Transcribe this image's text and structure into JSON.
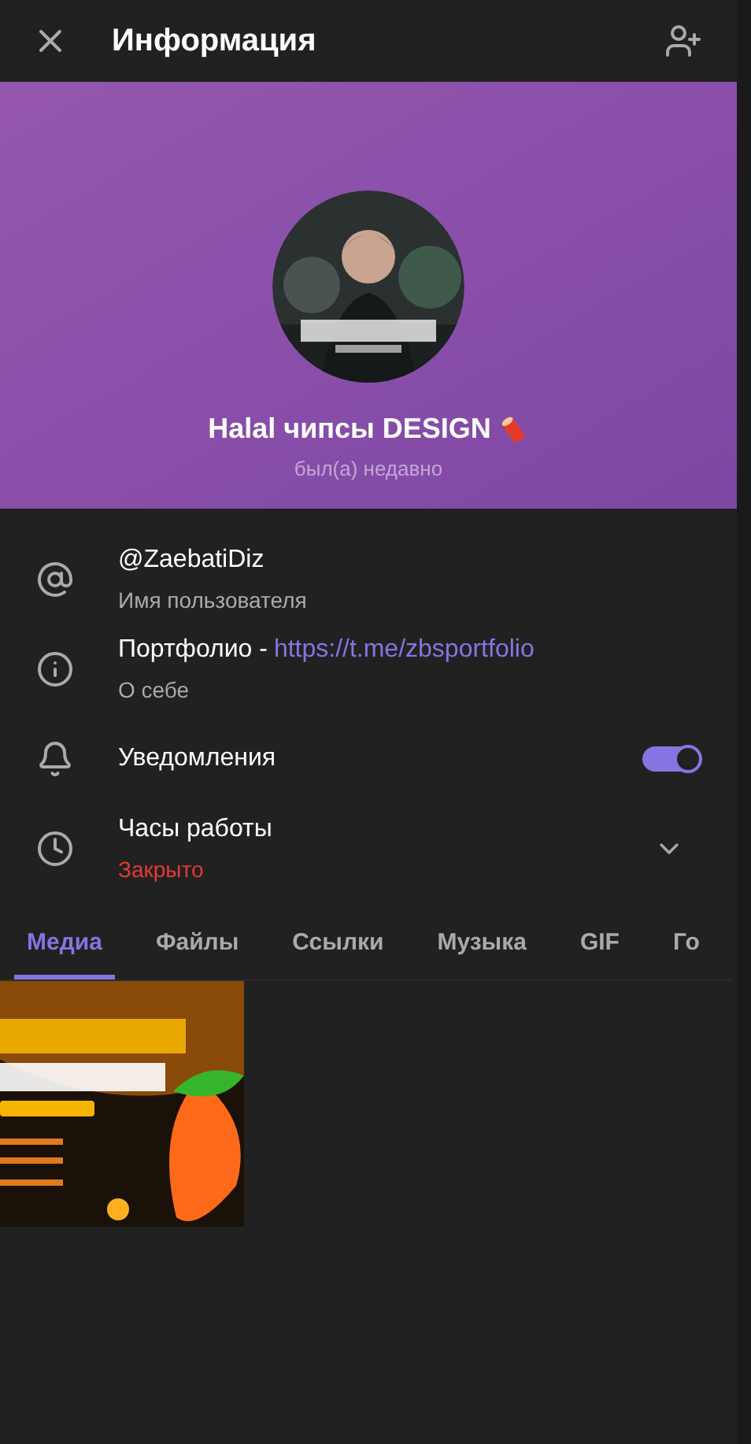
{
  "header": {
    "title": "Информация"
  },
  "profile": {
    "name": "Halal чипсы DESIGN",
    "status": "был(а) недавно"
  },
  "rows": [
    {
      "kind": "username",
      "title": "@ZaebatiDiz",
      "subtitle": "Имя пользователя"
    },
    {
      "kind": "bio",
      "title": "Портфолио -",
      "link": "https://t.me/zbsportfolio",
      "subtitle": "О себе"
    },
    {
      "kind": "notifications",
      "title": "Уведомления",
      "on": true
    },
    {
      "kind": "hours",
      "title": "Часы работы",
      "subtitle": "Закрыто",
      "expanded": false
    }
  ],
  "tabs": [
    {
      "label": "Медиа",
      "selected": true
    },
    {
      "label": "Файлы",
      "selected": false
    },
    {
      "label": "Ссылки",
      "selected": false
    },
    {
      "label": "Музыка",
      "selected": false
    },
    {
      "label": "GIF",
      "selected": false
    },
    {
      "label": "Го",
      "selected": false
    }
  ]
}
